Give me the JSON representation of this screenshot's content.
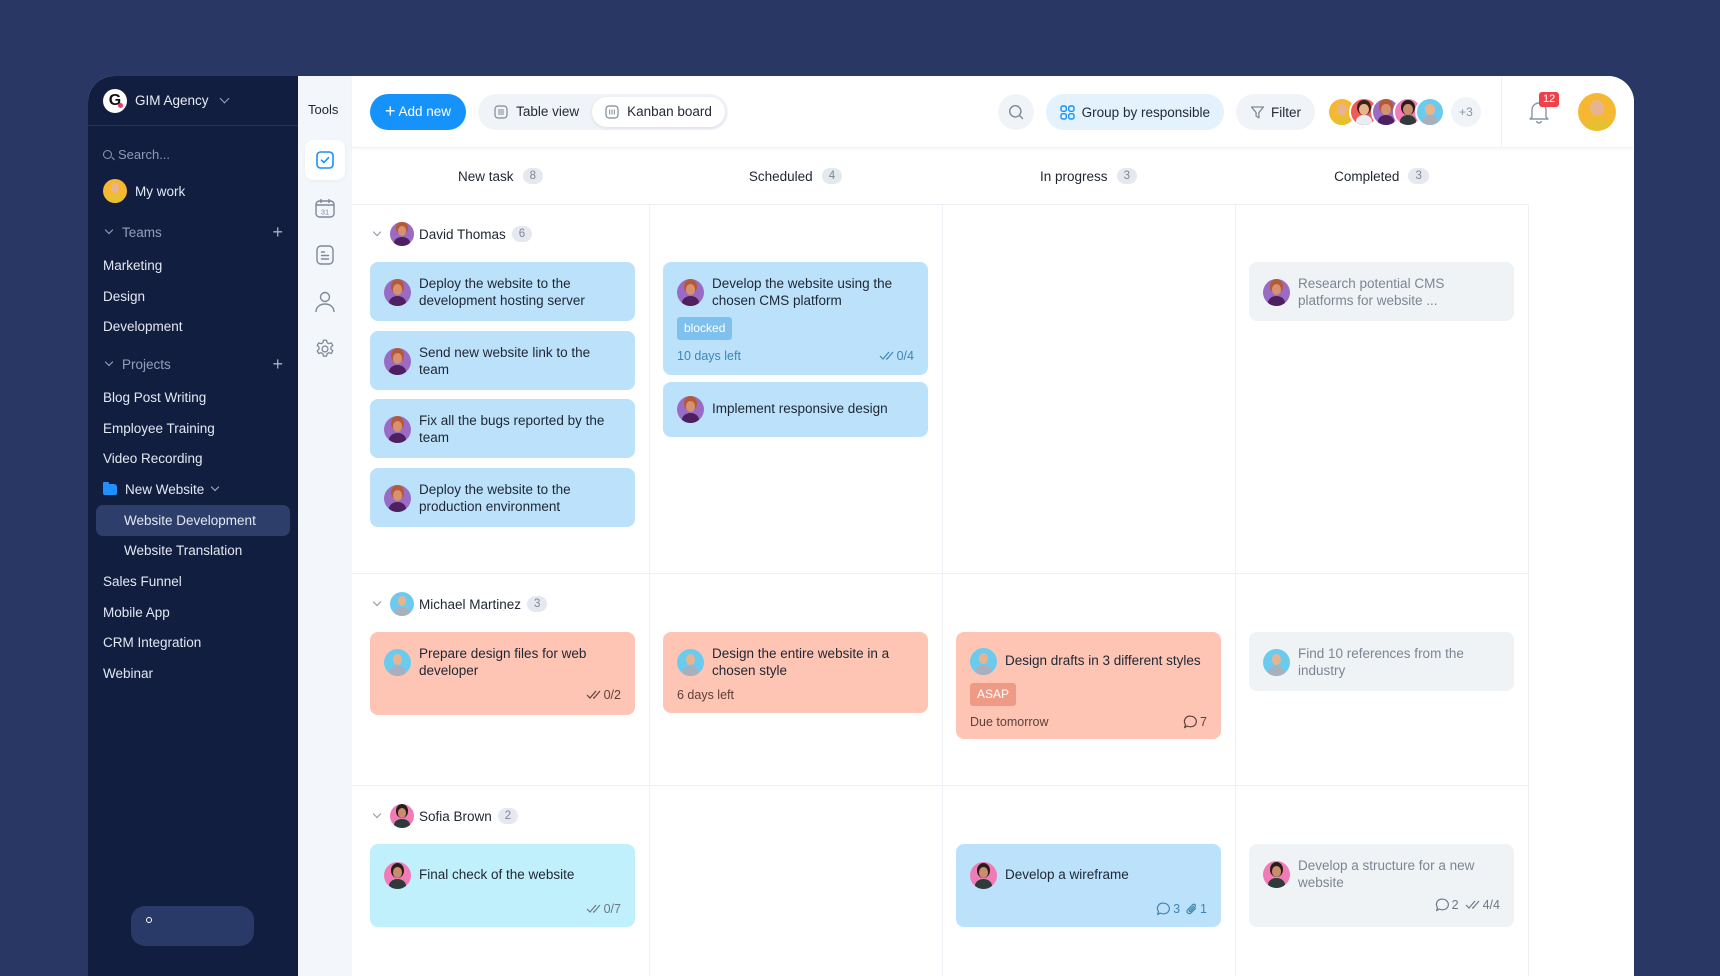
{
  "workspace": {
    "name": "GIM Agency",
    "logo_letter": "G"
  },
  "sidebar": {
    "search_placeholder": "Search...",
    "my_work": "My work",
    "teams_label": "Teams",
    "teams": [
      {
        "label": "Marketing"
      },
      {
        "label": "Design"
      },
      {
        "label": "Development"
      }
    ],
    "projects_label": "Projects",
    "projects": [
      {
        "label": "Blog Post Writing"
      },
      {
        "label": "Employee Training"
      },
      {
        "label": "Video Recording"
      },
      {
        "label": "New Website"
      },
      {
        "label": "Website Development"
      },
      {
        "label": "Website Translation"
      },
      {
        "label": "Sales Funnel"
      },
      {
        "label": "Mobile App"
      },
      {
        "label": "CRM Integration"
      },
      {
        "label": "Webinar"
      }
    ],
    "active_project": "Website Development"
  },
  "tools": {
    "label": "Tools",
    "items": [
      "tasks-icon",
      "calendar-icon",
      "notes-icon",
      "people-icon",
      "settings-icon"
    ],
    "calendar_day": "31"
  },
  "toolbar": {
    "add_new": "Add new",
    "views": [
      {
        "label": "Table view",
        "active": false
      },
      {
        "label": "Kanban board",
        "active": true
      }
    ],
    "group_by": "Group by responsible",
    "filter": "Filter",
    "members_more": "+3",
    "notifications_count": "12"
  },
  "colors": {
    "accent": "#1592FB",
    "sidebar_bg": "#111E3F",
    "page_bg": "#283763",
    "badge": "#F0404A"
  },
  "board": {
    "columns": [
      {
        "label": "New task",
        "count": "8"
      },
      {
        "label": "Scheduled",
        "count": "4"
      },
      {
        "label": "In progress",
        "count": "3"
      },
      {
        "label": "Completed",
        "count": "3"
      }
    ],
    "groups": [
      {
        "name": "David Thomas",
        "count": "6",
        "cards": {
          "new": [
            {
              "title": "Deploy the website to the development hosting server"
            },
            {
              "title": "Send new website link to the team"
            },
            {
              "title": "Fix all the bugs reported by the team"
            },
            {
              "title": "Deploy the website to the production environment"
            }
          ],
          "scheduled": [
            {
              "title": "Develop the website using the chosen CMS platform",
              "tag": "blocked",
              "due": "10 days left",
              "checklist": "0/4"
            },
            {
              "title": "Implement responsive design"
            }
          ],
          "completed": [
            {
              "title": "Research potential CMS platforms for website ..."
            }
          ]
        }
      },
      {
        "name": "Michael Martinez",
        "count": "3",
        "cards": {
          "new": [
            {
              "title": "Prepare design files for web developer",
              "checklist": "0/2"
            }
          ],
          "scheduled": [
            {
              "title": "Design the entire website in a chosen style",
              "due": "6 days left"
            }
          ],
          "in_progress": [
            {
              "title": "Design drafts in 3 different styles",
              "tag": "ASAP",
              "due": "Due tomorrow",
              "comments": "7"
            }
          ],
          "completed": [
            {
              "title": "Find 10 references from the industry"
            }
          ]
        }
      },
      {
        "name": "Sofia Brown",
        "count": "2",
        "cards": {
          "new": [
            {
              "title": "Final check of the website",
              "checklist": "0/7"
            }
          ],
          "in_progress": [
            {
              "title": "Develop a wireframe",
              "comments": "3",
              "attachments": "1"
            }
          ],
          "completed": [
            {
              "title": "Develop a structure for a new website",
              "comments": "2",
              "checklist": "4/4"
            }
          ]
        }
      }
    ]
  }
}
